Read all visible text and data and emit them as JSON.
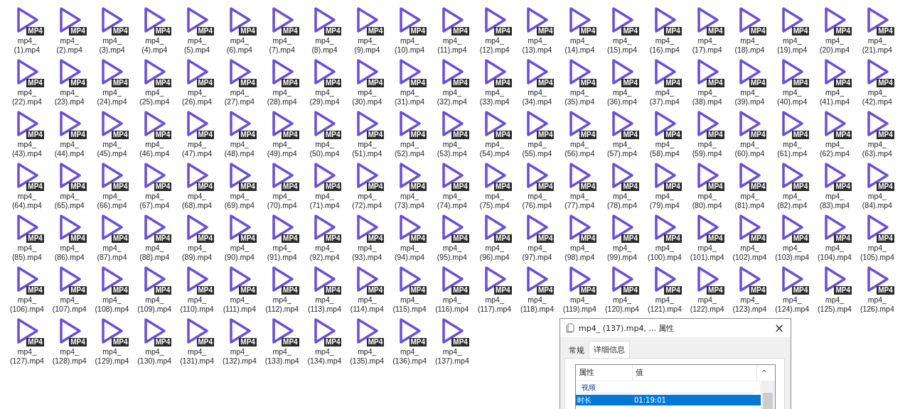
{
  "files": [
    {
      "name": "mp4_ (1).mp4",
      "badge": "MP4"
    },
    {
      "name": "mp4_ (2).mp4",
      "badge": "MP4"
    },
    {
      "name": "mp4_ (3).mp4",
      "badge": "MP4"
    },
    {
      "name": "mp4_ (4).mp4",
      "badge": "MP4"
    },
    {
      "name": "mp4_ (5).mp4",
      "badge": "MP4"
    },
    {
      "name": "mp4_ (6).mp4",
      "badge": "MP4"
    },
    {
      "name": "mp4_ (7).mp4",
      "badge": "MP4"
    },
    {
      "name": "mp4_ (8).mp4",
      "badge": "MP4"
    },
    {
      "name": "mp4_ (9).mp4",
      "badge": "MP4"
    },
    {
      "name": "mp4_ (10).mp4",
      "badge": "MP4"
    },
    {
      "name": "mp4_ (11).mp4",
      "badge": "MP4"
    },
    {
      "name": "mp4_ (12).mp4",
      "badge": "MP4"
    },
    {
      "name": "mp4_ (13).mp4",
      "badge": "MP4"
    },
    {
      "name": "mp4_ (14).mp4",
      "badge": "MP4"
    },
    {
      "name": "mp4_ (15).mp4",
      "badge": "MP4"
    },
    {
      "name": "mp4_ (16).mp4",
      "badge": "MP4"
    },
    {
      "name": "mp4_ (17).mp4",
      "badge": "MP4"
    },
    {
      "name": "mp4_ (18).mp4",
      "badge": "MP4"
    },
    {
      "name": "mp4_ (19).mp4",
      "badge": "MP4"
    },
    {
      "name": "mp4_ (20).mp4",
      "badge": "MP4"
    },
    {
      "name": "mp4_ (21).mp4",
      "badge": "MP4"
    },
    {
      "name": "mp4_ (22).mp4",
      "badge": "MP4"
    },
    {
      "name": "mp4_ (23).mp4",
      "badge": "MP4"
    },
    {
      "name": "mp4_ (24).mp4",
      "badge": "MP4"
    },
    {
      "name": "mp4_ (25).mp4",
      "badge": "MP4"
    },
    {
      "name": "mp4_ (26).mp4",
      "badge": "MP4"
    },
    {
      "name": "mp4_ (27).mp4",
      "badge": "MP4"
    },
    {
      "name": "mp4_ (28).mp4",
      "badge": "MP4"
    },
    {
      "name": "mp4_ (29).mp4",
      "badge": "MP4"
    },
    {
      "name": "mp4_ (30).mp4",
      "badge": "MP4"
    },
    {
      "name": "mp4_ (31).mp4",
      "badge": "MP4"
    },
    {
      "name": "mp4_ (32).mp4",
      "badge": "MP4"
    },
    {
      "name": "mp4_ (33).mp4",
      "badge": "MP4"
    },
    {
      "name": "mp4_ (34).mp4",
      "badge": "MP4"
    },
    {
      "name": "mp4_ (35).mp4",
      "badge": "MP4"
    },
    {
      "name": "mp4_ (36).mp4",
      "badge": "MP4"
    },
    {
      "name": "mp4_ (37).mp4",
      "badge": "MP4"
    },
    {
      "name": "mp4_ (38).mp4",
      "badge": "MP4"
    },
    {
      "name": "mp4_ (39).mp4",
      "badge": "MP4"
    },
    {
      "name": "mp4_ (40).mp4",
      "badge": "MP4"
    },
    {
      "name": "mp4_ (41).mp4",
      "badge": "MP4"
    },
    {
      "name": "mp4_ (42).mp4",
      "badge": "MP4"
    },
    {
      "name": "mp4_ (43).mp4",
      "badge": "MP4"
    },
    {
      "name": "mp4_ (44).mp4",
      "badge": "MP4"
    },
    {
      "name": "mp4_ (45).mp4",
      "badge": "MP4"
    },
    {
      "name": "mp4_ (46).mp4",
      "badge": "MP4"
    },
    {
      "name": "mp4_ (47).mp4",
      "badge": "MP4"
    },
    {
      "name": "mp4_ (48).mp4",
      "badge": "MP4"
    },
    {
      "name": "mp4_ (49).mp4",
      "badge": "MP4"
    },
    {
      "name": "mp4_ (50).mp4",
      "badge": "MP4"
    },
    {
      "name": "mp4_ (51).mp4",
      "badge": "MP4"
    },
    {
      "name": "mp4_ (52).mp4",
      "badge": "MP4"
    },
    {
      "name": "mp4_ (53).mp4",
      "badge": "MP4"
    },
    {
      "name": "mp4_ (54).mp4",
      "badge": "MP4"
    },
    {
      "name": "mp4_ (55).mp4",
      "badge": "MP4"
    },
    {
      "name": "mp4_ (56).mp4",
      "badge": "MP4"
    },
    {
      "name": "mp4_ (57).mp4",
      "badge": "MP4"
    },
    {
      "name": "mp4_ (58).mp4",
      "badge": "MP4"
    },
    {
      "name": "mp4_ (59).mp4",
      "badge": "MP4"
    },
    {
      "name": "mp4_ (60).mp4",
      "badge": "MP4"
    },
    {
      "name": "mp4_ (61).mp4",
      "badge": "MP4"
    },
    {
      "name": "mp4_ (62).mp4",
      "badge": "MP4"
    },
    {
      "name": "mp4_ (63).mp4",
      "badge": "MP4"
    },
    {
      "name": "mp4_ (64).mp4",
      "badge": "MP4"
    },
    {
      "name": "mp4_ (65).mp4",
      "badge": "MP4"
    },
    {
      "name": "mp4_ (66).mp4",
      "badge": "MP4"
    },
    {
      "name": "mp4_ (67).mp4",
      "badge": "MP4"
    },
    {
      "name": "mp4_ (68).mp4",
      "badge": "MP4"
    },
    {
      "name": "mp4_ (69).mp4",
      "badge": "MP4"
    },
    {
      "name": "mp4_ (70).mp4",
      "badge": "MP4"
    },
    {
      "name": "mp4_ (71).mp4",
      "badge": "MP4"
    },
    {
      "name": "mp4_ (72).mp4",
      "badge": "MP4"
    },
    {
      "name": "mp4_ (73).mp4",
      "badge": "MP4"
    },
    {
      "name": "mp4_ (74).mp4",
      "badge": "MP4"
    },
    {
      "name": "mp4_ (75).mp4",
      "badge": "MP4"
    },
    {
      "name": "mp4_ (76).mp4",
      "badge": "MP4"
    },
    {
      "name": "mp4_ (77).mp4",
      "badge": "MP4"
    },
    {
      "name": "mp4_ (78).mp4",
      "badge": "MP4"
    },
    {
      "name": "mp4_ (79).mp4",
      "badge": "MP4"
    },
    {
      "name": "mp4_ (80).mp4",
      "badge": "MP4"
    },
    {
      "name": "mp4_ (81).mp4",
      "badge": "MP4"
    },
    {
      "name": "mp4_ (82).mp4",
      "badge": "MP4"
    },
    {
      "name": "mp4_ (83).mp4",
      "badge": "MP4"
    },
    {
      "name": "mp4_ (84).mp4",
      "badge": "MP4"
    },
    {
      "name": "mp4_ (85).mp4",
      "badge": "MP4"
    },
    {
      "name": "mp4_ (86).mp4",
      "badge": "MP4"
    },
    {
      "name": "mp4_ (87).mp4",
      "badge": "MP4"
    },
    {
      "name": "mp4_ (88).mp4",
      "badge": "MP4"
    },
    {
      "name": "mp4_ (89).mp4",
      "badge": "MP4"
    },
    {
      "name": "mp4_ (90).mp4",
      "badge": "MP4"
    },
    {
      "name": "mp4_ (91).mp4",
      "badge": "MP4"
    },
    {
      "name": "mp4_ (92).mp4",
      "badge": "MP4"
    },
    {
      "name": "mp4_ (93).mp4",
      "badge": "MP4"
    },
    {
      "name": "mp4_ (94).mp4",
      "badge": "MP4"
    },
    {
      "name": "mp4_ (95).mp4",
      "badge": "MP4"
    },
    {
      "name": "mp4_ (96).mp4",
      "badge": "MP4"
    },
    {
      "name": "mp4_ (97).mp4",
      "badge": "MP4"
    },
    {
      "name": "mp4_ (98).mp4",
      "badge": "MP4"
    },
    {
      "name": "mp4_ (99).mp4",
      "badge": "MP4"
    },
    {
      "name": "mp4_ (100).mp4",
      "badge": "MP4"
    },
    {
      "name": "mp4_ (101).mp4",
      "badge": "MP4"
    },
    {
      "name": "mp4_ (102).mp4",
      "badge": "MP4"
    },
    {
      "name": "mp4_ (103).mp4",
      "badge": "MP4"
    },
    {
      "name": "mp4_ (104).mp4",
      "badge": "MP4"
    },
    {
      "name": "mp4_ (105).mp4",
      "badge": "MP4"
    },
    {
      "name": "mp4_ (106).mp4",
      "badge": "MP4"
    },
    {
      "name": "mp4_ (107).mp4",
      "badge": "MP4"
    },
    {
      "name": "mp4_ (108).mp4",
      "badge": "MP4"
    },
    {
      "name": "mp4_ (109).mp4",
      "badge": "MP4"
    },
    {
      "name": "mp4_ (110).mp4",
      "badge": "MP4"
    },
    {
      "name": "mp4_ (111).mp4",
      "badge": "MP4"
    },
    {
      "name": "mp4_ (112).mp4",
      "badge": "MP4"
    },
    {
      "name": "mp4_ (113).mp4",
      "badge": "MP4"
    },
    {
      "name": "mp4_ (114).mp4",
      "badge": "MP4"
    },
    {
      "name": "mp4_ (115).mp4",
      "badge": "MP4"
    },
    {
      "name": "mp4_ (116).mp4",
      "badge": "MP4"
    },
    {
      "name": "mp4_ (117).mp4",
      "badge": "MP4"
    },
    {
      "name": "mp4_ (118).mp4",
      "badge": "MP4"
    },
    {
      "name": "mp4_ (119).mp4",
      "badge": "MP4"
    },
    {
      "name": "mp4_ (120).mp4",
      "badge": "MP4"
    },
    {
      "name": "mp4_ (121).mp4",
      "badge": "MP4"
    },
    {
      "name": "mp4_ (122).mp4",
      "badge": "MP4"
    },
    {
      "name": "mp4_ (123).mp4",
      "badge": "MP4"
    },
    {
      "name": "mp4_ (124).mp4",
      "badge": "MP4"
    },
    {
      "name": "mp4_ (125).mp4",
      "badge": "MP4"
    },
    {
      "name": "mp4_ (126).mp4",
      "badge": "MP4"
    },
    {
      "name": "mp4_ (127).mp4",
      "badge": "MP4"
    },
    {
      "name": "mp4_ (128).mp4",
      "badge": "MP4"
    },
    {
      "name": "mp4_ (129).mp4",
      "badge": "MP4"
    },
    {
      "name": "mp4_ (130).mp4",
      "badge": "MP4"
    },
    {
      "name": "mp4_ (131).mp4",
      "badge": "MP4"
    },
    {
      "name": "mp4_ (132).mp4",
      "badge": "MP4"
    },
    {
      "name": "mp4_ (133).mp4",
      "badge": "MP4"
    },
    {
      "name": "mp4_ (134).mp4",
      "badge": "MP4"
    },
    {
      "name": "mp4_ (135).mp4",
      "badge": "MP4"
    },
    {
      "name": "mp4_ (136).mp4",
      "badge": "MP4"
    },
    {
      "name": "mp4_ (137).mp4",
      "badge": "MP4"
    }
  ],
  "properties_dialog": {
    "title": "mp4_ (137).mp4, ... 属性",
    "close": "×",
    "tabs": [
      {
        "label": "常规",
        "selected": false
      },
      {
        "label": "详细信息",
        "selected": true
      }
    ],
    "columns": [
      "属性",
      "值"
    ],
    "scroll_up": "^",
    "group": "视频",
    "rows": [
      {
        "property": "时长",
        "value": "01:19:01",
        "selected": true
      }
    ]
  }
}
